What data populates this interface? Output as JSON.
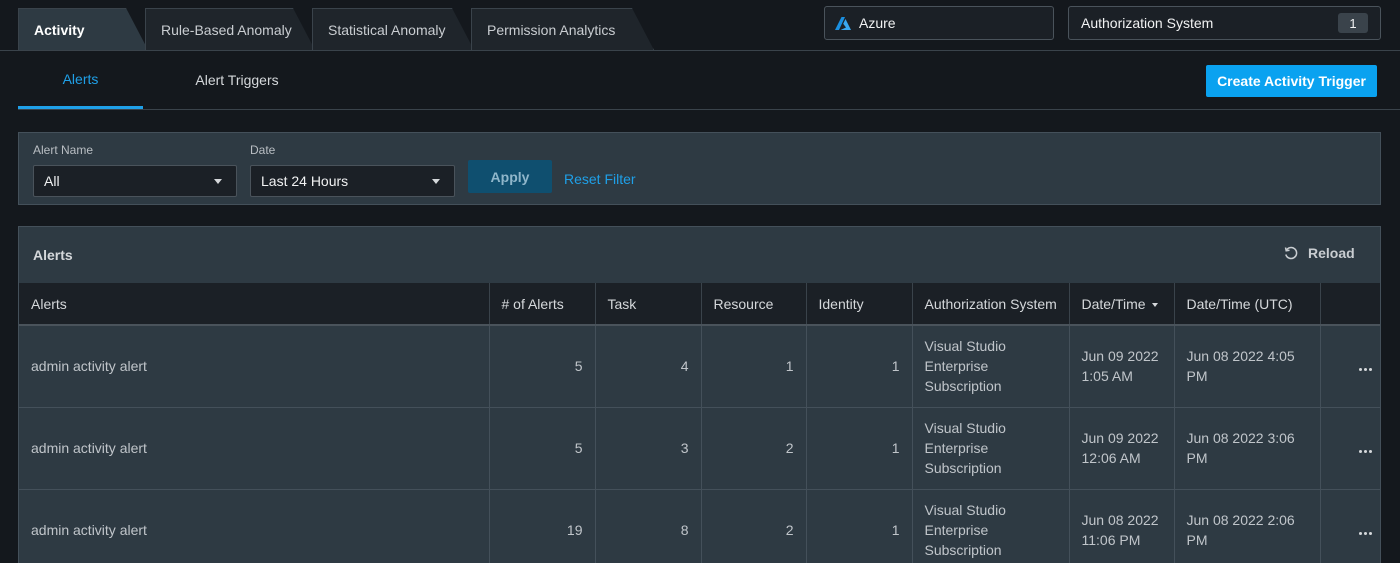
{
  "top_tabs": [
    {
      "label": "Activity",
      "active": true
    },
    {
      "label": "Rule-Based Anomaly",
      "active": false
    },
    {
      "label": "Statistical Anomaly",
      "active": false
    },
    {
      "label": "Permission Analytics",
      "active": false
    }
  ],
  "cloud": {
    "label": "Azure",
    "icon": "azure-logo-icon"
  },
  "auth_system": {
    "label": "Authorization System",
    "count": "1"
  },
  "sub_tabs": [
    {
      "label": "Alerts",
      "active": true
    },
    {
      "label": "Alert Triggers",
      "active": false
    }
  ],
  "create_button": "Create Activity Trigger",
  "filter": {
    "alert_name_label": "Alert Name",
    "alert_name_value": "All",
    "date_label": "Date",
    "date_value": "Last 24 Hours",
    "apply": "Apply",
    "reset": "Reset Filter"
  },
  "alerts_panel": {
    "title": "Alerts",
    "reload": "Reload"
  },
  "table": {
    "columns": [
      "Alerts",
      "# of Alerts",
      "Task",
      "Resource",
      "Identity",
      "Authorization System",
      "Date/Time",
      "Date/Time (UTC)"
    ],
    "rows": [
      {
        "alert": "admin activity alert",
        "count": "5",
        "task": "4",
        "resource": "1",
        "identity": "1",
        "auth": "Visual Studio Enterprise Subscription",
        "datetime": "Jun 09 2022 1:05 AM",
        "utc": "Jun 08 2022 4:05 PM"
      },
      {
        "alert": "admin activity alert",
        "count": "5",
        "task": "3",
        "resource": "2",
        "identity": "1",
        "auth": "Visual Studio Enterprise Subscription",
        "datetime": "Jun 09 2022 12:06 AM",
        "utc": "Jun 08 2022 3:06 PM"
      },
      {
        "alert": "admin activity alert",
        "count": "19",
        "task": "8",
        "resource": "2",
        "identity": "1",
        "auth": "Visual Studio Enterprise Subscription",
        "datetime": "Jun 08 2022 11:06 PM",
        "utc": "Jun 08 2022 2:06 PM"
      }
    ]
  },
  "colors": {
    "accent": "#0aa2f0",
    "background": "#14181d",
    "panel": "#2e3a43"
  }
}
